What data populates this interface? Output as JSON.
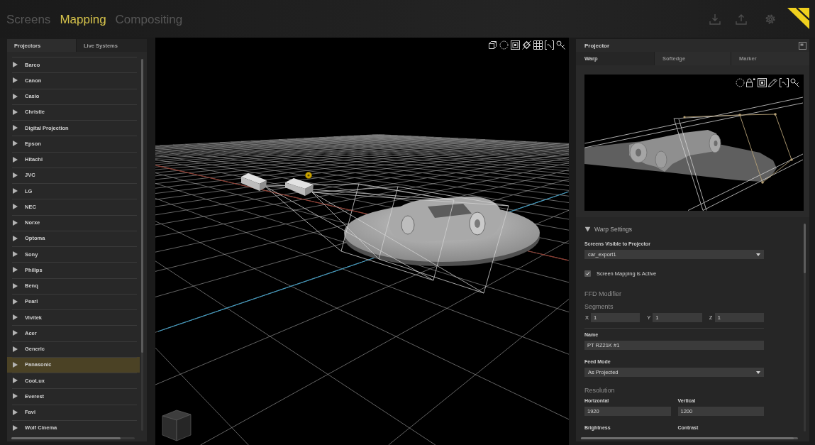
{
  "top_bar": {
    "tabs": [
      {
        "label": "Screens",
        "selected": false
      },
      {
        "label": "Mapping",
        "selected": true
      },
      {
        "label": "Compositing",
        "selected": false
      }
    ]
  },
  "projector_library": {
    "tabs": [
      {
        "label": "Projectors",
        "selected": true
      },
      {
        "label": "Live Systems",
        "selected": false
      }
    ],
    "items": [
      {
        "label": "Barco",
        "expanded": false,
        "selected": false
      },
      {
        "label": "Canon",
        "expanded": false,
        "selected": false
      },
      {
        "label": "Casio",
        "expanded": false,
        "selected": false
      },
      {
        "label": "Christie",
        "expanded": false,
        "selected": false
      },
      {
        "label": "Digital Projection",
        "expanded": false,
        "selected": false
      },
      {
        "label": "Epson",
        "expanded": false,
        "selected": false
      },
      {
        "label": "Hitachi",
        "expanded": false,
        "selected": false
      },
      {
        "label": "JVC",
        "expanded": false,
        "selected": false
      },
      {
        "label": "LG",
        "expanded": false,
        "selected": false
      },
      {
        "label": "NEC",
        "expanded": false,
        "selected": false
      },
      {
        "label": "Norxe",
        "expanded": false,
        "selected": false
      },
      {
        "label": "Optoma",
        "expanded": false,
        "selected": false
      },
      {
        "label": "Sony",
        "expanded": false,
        "selected": false
      },
      {
        "label": "Philips",
        "expanded": false,
        "selected": false
      },
      {
        "label": "Benq",
        "expanded": false,
        "selected": false
      },
      {
        "label": "Pearl",
        "expanded": false,
        "selected": false
      },
      {
        "label": "Vivitek",
        "expanded": false,
        "selected": false
      },
      {
        "label": "Acer",
        "expanded": false,
        "selected": false
      },
      {
        "label": "Generic",
        "expanded": false,
        "selected": false
      },
      {
        "label": "Panasonic",
        "expanded": false,
        "selected": true
      },
      {
        "label": "CooLux",
        "expanded": false,
        "selected": false
      },
      {
        "label": "Everest",
        "expanded": false,
        "selected": false
      },
      {
        "label": "Favi",
        "expanded": false,
        "selected": false
      },
      {
        "label": "Wolf Cinema",
        "expanded": false,
        "selected": false
      }
    ]
  },
  "projector_panel": {
    "title": "Projector",
    "tabs": [
      {
        "label": "Warp",
        "selected": true
      },
      {
        "label": "Softedge",
        "selected": false
      },
      {
        "label": "Marker",
        "selected": false
      }
    ],
    "warp_settings": {
      "title": "Warp Settings",
      "expanded": true,
      "rows": [
        {
          "kind": "dropdown",
          "label": "Screens Visible to Projector",
          "value": "car_export1"
        },
        {
          "kind": "checkbox",
          "label": "Screen Mapping is Active",
          "checked": true
        },
        {
          "kind": "heading",
          "label": "FFD Modifier"
        },
        {
          "kind": "heading",
          "label": "Segments"
        },
        {
          "kind": "xyz",
          "fields": [
            {
              "label": "X",
              "value": "1"
            },
            {
              "label": "Y",
              "value": "1"
            },
            {
              "label": "Z",
              "value": "1"
            }
          ]
        },
        {
          "kind": "text",
          "label": "Name",
          "value": "PT RZ21K #1"
        },
        {
          "kind": "dropdown",
          "label": "Feed Mode",
          "value": "As Projected"
        },
        {
          "kind": "heading",
          "label": "Resolution"
        },
        {
          "kind": "pair",
          "fields": [
            {
              "label": "Horizontal",
              "value": "1920"
            },
            {
              "label": "Vertical",
              "value": "1200"
            }
          ]
        },
        {
          "kind": "pair",
          "fields": [
            {
              "label": "Brightness"
            },
            {
              "label": "Contrast"
            }
          ]
        }
      ]
    }
  }
}
